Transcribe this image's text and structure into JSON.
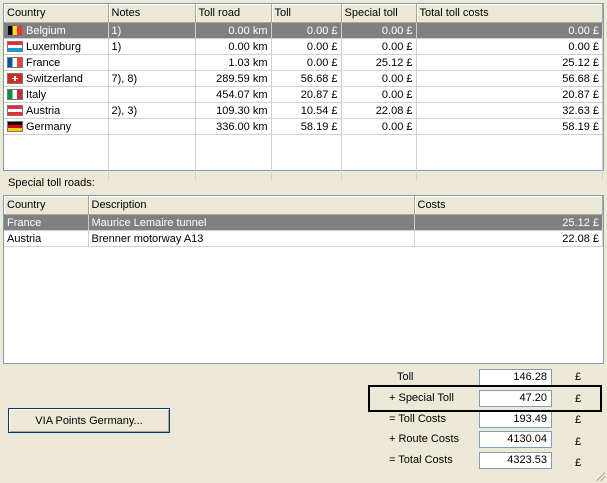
{
  "toll_table": {
    "columns": [
      "Country",
      "Notes",
      "Toll road",
      "Toll",
      "Special toll",
      "Total toll costs"
    ],
    "rows": [
      {
        "flag": "be",
        "country": "Belgium",
        "notes": "1)",
        "toll_road": "0.00 km",
        "toll": "0.00 £",
        "special_toll": "0.00 £",
        "total": "0.00 £",
        "selected": true
      },
      {
        "flag": "lu",
        "country": "Luxemburg",
        "notes": "1)",
        "toll_road": "0.00 km",
        "toll": "0.00 £",
        "special_toll": "0.00 £",
        "total": "0.00 £",
        "selected": false
      },
      {
        "flag": "fr",
        "country": "France",
        "notes": "",
        "toll_road": "1.03 km",
        "toll": "0.00 £",
        "special_toll": "25.12 £",
        "total": "25.12 £",
        "selected": false
      },
      {
        "flag": "ch",
        "country": "Switzerland",
        "notes": "7), 8)",
        "toll_road": "289.59 km",
        "toll": "56.68 £",
        "special_toll": "0.00 £",
        "total": "56.68 £",
        "selected": false
      },
      {
        "flag": "it",
        "country": "Italy",
        "notes": "",
        "toll_road": "454.07 km",
        "toll": "20.87 £",
        "special_toll": "0.00 £",
        "total": "20.87 £",
        "selected": false
      },
      {
        "flag": "at",
        "country": "Austria",
        "notes": "2), 3)",
        "toll_road": "109.30 km",
        "toll": "10.54 £",
        "special_toll": "22.08 £",
        "total": "32.63 £",
        "selected": false
      },
      {
        "flag": "de",
        "country": "Germany",
        "notes": "",
        "toll_road": "336.00 km",
        "toll": "58.19 £",
        "special_toll": "0.00 £",
        "total": "58.19 £",
        "selected": false
      }
    ]
  },
  "special_section": {
    "label": "Special toll roads:",
    "columns": [
      "Country",
      "Description",
      "Costs"
    ],
    "rows": [
      {
        "country": "France",
        "description": "Maurice Lemaire tunnel",
        "costs": "25.12 £",
        "selected": true
      },
      {
        "country": "Austria",
        "description": "Brenner motorway A13",
        "costs": "22.08 £",
        "selected": false
      }
    ]
  },
  "summary": {
    "currency": "£",
    "items": [
      {
        "label": "Toll",
        "value": "146.28"
      },
      {
        "label": "+ Special Toll",
        "value": "47.20"
      },
      {
        "label": "= Toll Costs",
        "value": "193.49"
      },
      {
        "label": "+ Route Costs",
        "value": "4130.04"
      },
      {
        "label": "= Total Costs",
        "value": "4323.53"
      }
    ]
  },
  "via_button": {
    "label": "VIA Points Germany..."
  }
}
